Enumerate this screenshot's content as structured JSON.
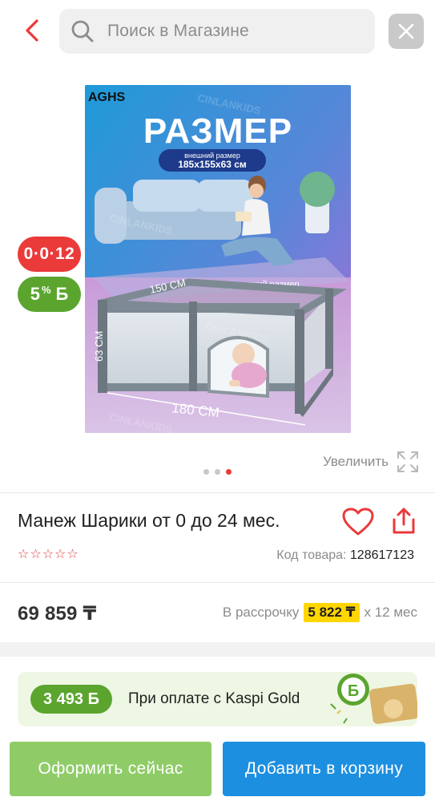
{
  "search": {
    "placeholder": "Поиск в Магазине"
  },
  "icons": {
    "back": "chevron-left-icon",
    "search": "search-icon",
    "close": "close-icon",
    "zoom": "expand-icon",
    "favorite": "heart-icon",
    "share": "share-icon",
    "rating": "star-outline-icon"
  },
  "product_image": {
    "brand": "AGHS",
    "watermark": "CINLANKIDS",
    "headline": "РАЗМЕР",
    "outer_label": "внешний размер",
    "outer_size": "185х155х63 см",
    "inner_label": "внутренний размер",
    "dim_width": "150 CM",
    "dim_height": "63 CM",
    "dim_length": "180 CM"
  },
  "badges": {
    "installment": "0·0·12",
    "bonus_percent": "5",
    "bonus_suffix": "%",
    "bonus_currency": "Б"
  },
  "gallery": {
    "dot_count": 3,
    "active_index": 2,
    "zoom_label": "Увеличить"
  },
  "product": {
    "title": "Манеж Шарики от 0 до 24 мес.",
    "rating_stars": 0,
    "sku_label": "Код товара:",
    "sku_value": "128617123"
  },
  "price": {
    "value": "69 859 ₸",
    "installment_label": "В рассрочку",
    "installment_amount": "5 822 ₸",
    "installment_months": "х 12 мес"
  },
  "promo": {
    "bonus": "3 493 Б",
    "text": "При оплате с Kaspi Gold"
  },
  "actions": {
    "checkout": "Оформить сейчас",
    "add_to_cart": "Добавить в корзину"
  },
  "colors": {
    "accent_red": "#ea3a3a",
    "bonus_green": "#5ba52f",
    "checkout_green": "#8fcc68",
    "cart_blue": "#1d8fe0",
    "installment_yellow": "#ffd600"
  }
}
